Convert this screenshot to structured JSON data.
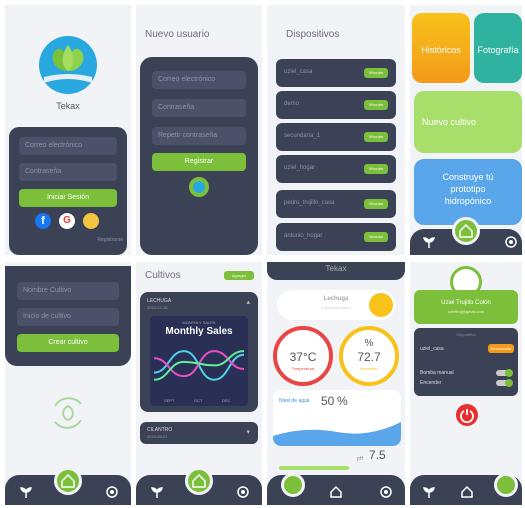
{
  "login": {
    "app_name": "Tekax",
    "email_placeholder": "Correo electrónico",
    "password_placeholder": "Contraseña",
    "login_button": "Iniciar Sesión",
    "register_link": "Registrarse"
  },
  "new_user": {
    "title": "Nuevo usuario",
    "email_placeholder": "Correo electrónico",
    "password_placeholder": "Contraseña",
    "repeat_placeholder": "Repetir contraseña",
    "register_button": "Registrar"
  },
  "devices": {
    "title": "Dispositivos",
    "button_label": "Vincular",
    "items": [
      "uziel_casa",
      "demo",
      "secundaria_1",
      "uziel_hogar",
      "pedro_trujillo_casa",
      "antonio_hogar"
    ]
  },
  "menu": {
    "historicos": "Históricos",
    "fotografia": "Fotografía",
    "nuevo_cultivo": "Nuevo cultivo",
    "construye": "Construye tú prototipo hidropónico"
  },
  "crop_form": {
    "name_placeholder": "Nombre Cultivo",
    "start_placeholder": "Inicio de cultivo",
    "create_button": "Crear cultivo"
  },
  "crops": {
    "title": "Cultivos",
    "add_button": "Agregar",
    "item1_name": "LECHUGA",
    "item1_date": "2024-04-18",
    "chart_caption": "MONTHLY SALES",
    "chart_title": "Monthly Sales",
    "chart_x": [
      "SEPT",
      "OCT",
      "DEC"
    ],
    "item2_name": "CILANTRO",
    "item2_date": "2024-05-01"
  },
  "dashboard": {
    "app_name": "Tekax",
    "crop": "Lechuga",
    "crop_sub": "0 días de cultivo",
    "temp_value": "37°C",
    "temp_label": "Temperatura",
    "hum_unit": "%",
    "hum_value": "72.7",
    "hum_label": "Humedad",
    "water_label": "Nivel de agua",
    "water_value": "50",
    "water_unit": "%",
    "ph_label": "pH",
    "ph_value": "7.5"
  },
  "profile": {
    "name": "Uziel Trujillo Colón",
    "email": "uzieltruj@gmail.com",
    "section": "Dispositivo",
    "device": "uziel_casa",
    "device_button": "Desvincular",
    "pump_label": "Bomba manual",
    "on_label": "Encender"
  },
  "chart_data": {
    "type": "line",
    "title": "Monthly Sales",
    "categories": [
      "SEPT",
      "OCT",
      "DEC"
    ],
    "series": [
      {
        "values": [
          30,
          60,
          20,
          55
        ]
      },
      {
        "values": [
          50,
          25,
          60,
          35
        ]
      },
      {
        "values": [
          20,
          45,
          40,
          60
        ]
      }
    ]
  }
}
